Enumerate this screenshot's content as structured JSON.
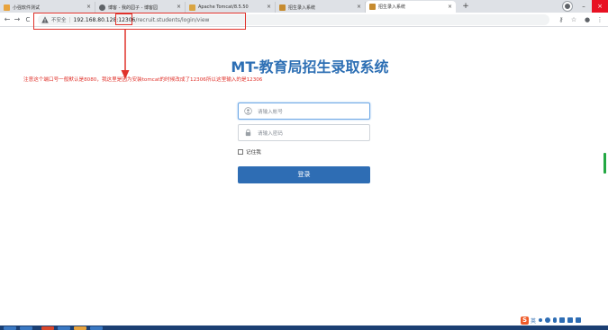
{
  "browser": {
    "tabs": [
      {
        "title": "小强软件测试",
        "favicon_color": "#e8a33d",
        "active": false
      },
      {
        "title": "博客 - 我的园子 - 博客园",
        "favicon_color": "#5f6368",
        "active": false
      },
      {
        "title": "Apache Tomcat/8.5.50",
        "favicon_color": "#d9a441",
        "active": false
      },
      {
        "title": "招生录入系统",
        "favicon_color": "#c68b2f",
        "active": false
      },
      {
        "title": "招生录入系统",
        "favicon_color": "#c68b2f",
        "active": true
      }
    ],
    "close_glyph": "×",
    "new_tab_glyph": "+",
    "window_controls": {
      "minimize": "–",
      "maximize": "□",
      "close": "×"
    },
    "nav": {
      "back": "←",
      "forward": "→",
      "reload": "C"
    },
    "address": {
      "security_label": "不安全",
      "separator": "|",
      "host": "192.168.80.128:",
      "port": "12306",
      "path": "/recruit.students/login/view"
    },
    "toolbar_icons": {
      "key": "⚷",
      "star": "☆",
      "profile": "●",
      "menu": "⋮"
    }
  },
  "page": {
    "title": "MT-教育局招生录取系统",
    "notice": "注意这个端口号一般默认是8080，我这里是因为安装tomcat的时候改成了12306所以这里输入的是12306",
    "username_placeholder": "请输入帐号",
    "password_placeholder": "请输入密码",
    "remember_label": "记住我",
    "login_label": "登录"
  },
  "ime": {
    "logo": "S",
    "mode": "英",
    "icons": [
      "punctuation-icon",
      "emoji-icon",
      "microphone-icon",
      "keyboard-icon",
      "skin-icon",
      "toolbox-icon"
    ]
  },
  "colors": {
    "annotation": "#e0322b",
    "title": "#2d6fb4",
    "button": "#2e6db4",
    "taskbar": "#1b3f73"
  }
}
